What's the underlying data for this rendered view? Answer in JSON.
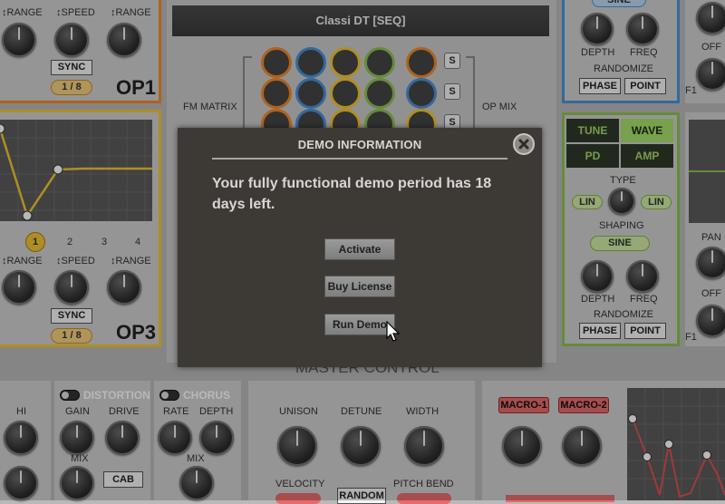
{
  "op1": {
    "range_left": "RANGE",
    "speed": "SPEED",
    "range_right": "RANGE",
    "sync": "SYNC",
    "rate": "1 / 8",
    "name": "OP1"
  },
  "op3": {
    "steps": [
      "1",
      "2",
      "3",
      "4"
    ],
    "range_left": "RANGE",
    "speed": "SPEED",
    "range_right": "RANGE",
    "sync": "SYNC",
    "rate": "1 / 8",
    "name": "OP3"
  },
  "center": {
    "preset_title": "Classi DT [SEQ]",
    "fm_matrix": "FM MATRIX",
    "op_mix": "OP MIX",
    "solo": [
      "S",
      "S",
      "S"
    ],
    "master_control": "MASTER CONTROL"
  },
  "right_top": {
    "sine_pill": "SINE",
    "depth": "DEPTH",
    "freq": "FREQ",
    "randomize": "RANDOMIZE",
    "phase": "PHASE",
    "point": "POINT",
    "off": "OFF",
    "f1": "F1"
  },
  "right_mid": {
    "tabs": [
      "TUNE",
      "WAVE",
      "PD",
      "AMP"
    ],
    "type": "TYPE",
    "lin_left": "LIN",
    "lin_right": "LIN",
    "shaping": "SHAPING",
    "sine": "SINE",
    "depth": "DEPTH",
    "freq": "FREQ",
    "randomize": "RANDOMIZE",
    "phase": "PHASE",
    "point": "POINT",
    "pan": "PAN",
    "off": "OFF",
    "f1": "F1"
  },
  "bottom": {
    "hi": "HI",
    "distortion": "DISTORTION",
    "gain": "GAIN",
    "drive": "DRIVE",
    "mix": "MIX",
    "cab": "CAB",
    "chorus": "CHORUS",
    "rate": "RATE",
    "depth": "DEPTH",
    "chorus_mix": "MIX",
    "unison": "UNISON",
    "detune": "DETUNE",
    "width": "WIDTH",
    "velocity": "VELOCITY",
    "random": "RANDOM",
    "pitch_bend": "PITCH BEND",
    "macro1": "MACRO-1",
    "macro2": "MACRO-2"
  },
  "dialog": {
    "title": "DEMO INFORMATION",
    "message": "Your fully functional demo period has 18 days left.",
    "activate": "Activate",
    "buy_license": "Buy License",
    "run_demo": "Run Demo"
  },
  "colors": {
    "op1_accent": "#f08a2a",
    "op3_accent": "#f2c531",
    "green_accent": "#8cc152",
    "blue_accent": "#4a90d9",
    "dialog_bg": "#3d3a36",
    "macro_red": "#e66b6b"
  }
}
